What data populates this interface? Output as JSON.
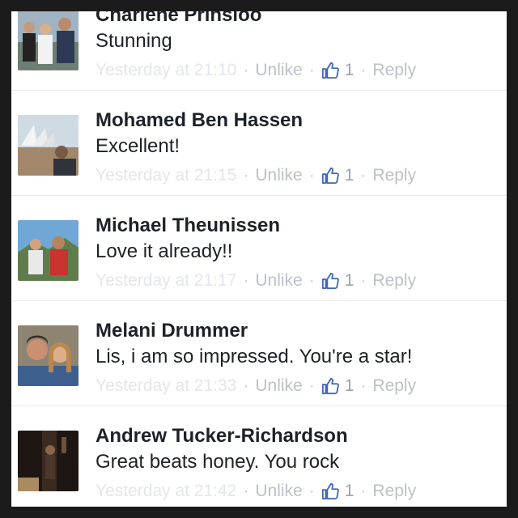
{
  "comments": [
    {
      "name": "Charlene Prinsloo",
      "text": "Stunning",
      "time": "Yesterday at 21:10",
      "unlike": "Unlike",
      "likes": "1",
      "reply": "Reply",
      "avatar_icon": "wedding-group-photo"
    },
    {
      "name": "Mohamed Ben Hassen",
      "text": "Excellent!",
      "time": "Yesterday at 21:15",
      "unlike": "Unlike",
      "likes": "1",
      "reply": "Reply",
      "avatar_icon": "opera-house-photo"
    },
    {
      "name": "Michael Theunissen",
      "text": "Love it already!!",
      "time": "Yesterday at 21:17",
      "unlike": "Unlike",
      "likes": "1",
      "reply": "Reply",
      "avatar_icon": "mountain-couple-photo"
    },
    {
      "name": "Melani Drummer",
      "text": "Lis, i am so impressed.  You're a star!",
      "time": "Yesterday at 21:33",
      "unlike": "Unlike",
      "likes": "1",
      "reply": "Reply",
      "avatar_icon": "couple-selfie-photo"
    },
    {
      "name": "Andrew Tucker-Richardson",
      "text": "Great beats honey. You rock",
      "time": "Yesterday at 21:42",
      "unlike": "Unlike",
      "likes": "1",
      "reply": "Reply",
      "avatar_icon": "dark-studio-photo"
    }
  ],
  "colors": {
    "like_blue": "#4267b2",
    "name_text": "#1d2129",
    "frame_border": "#1b1b1b"
  }
}
